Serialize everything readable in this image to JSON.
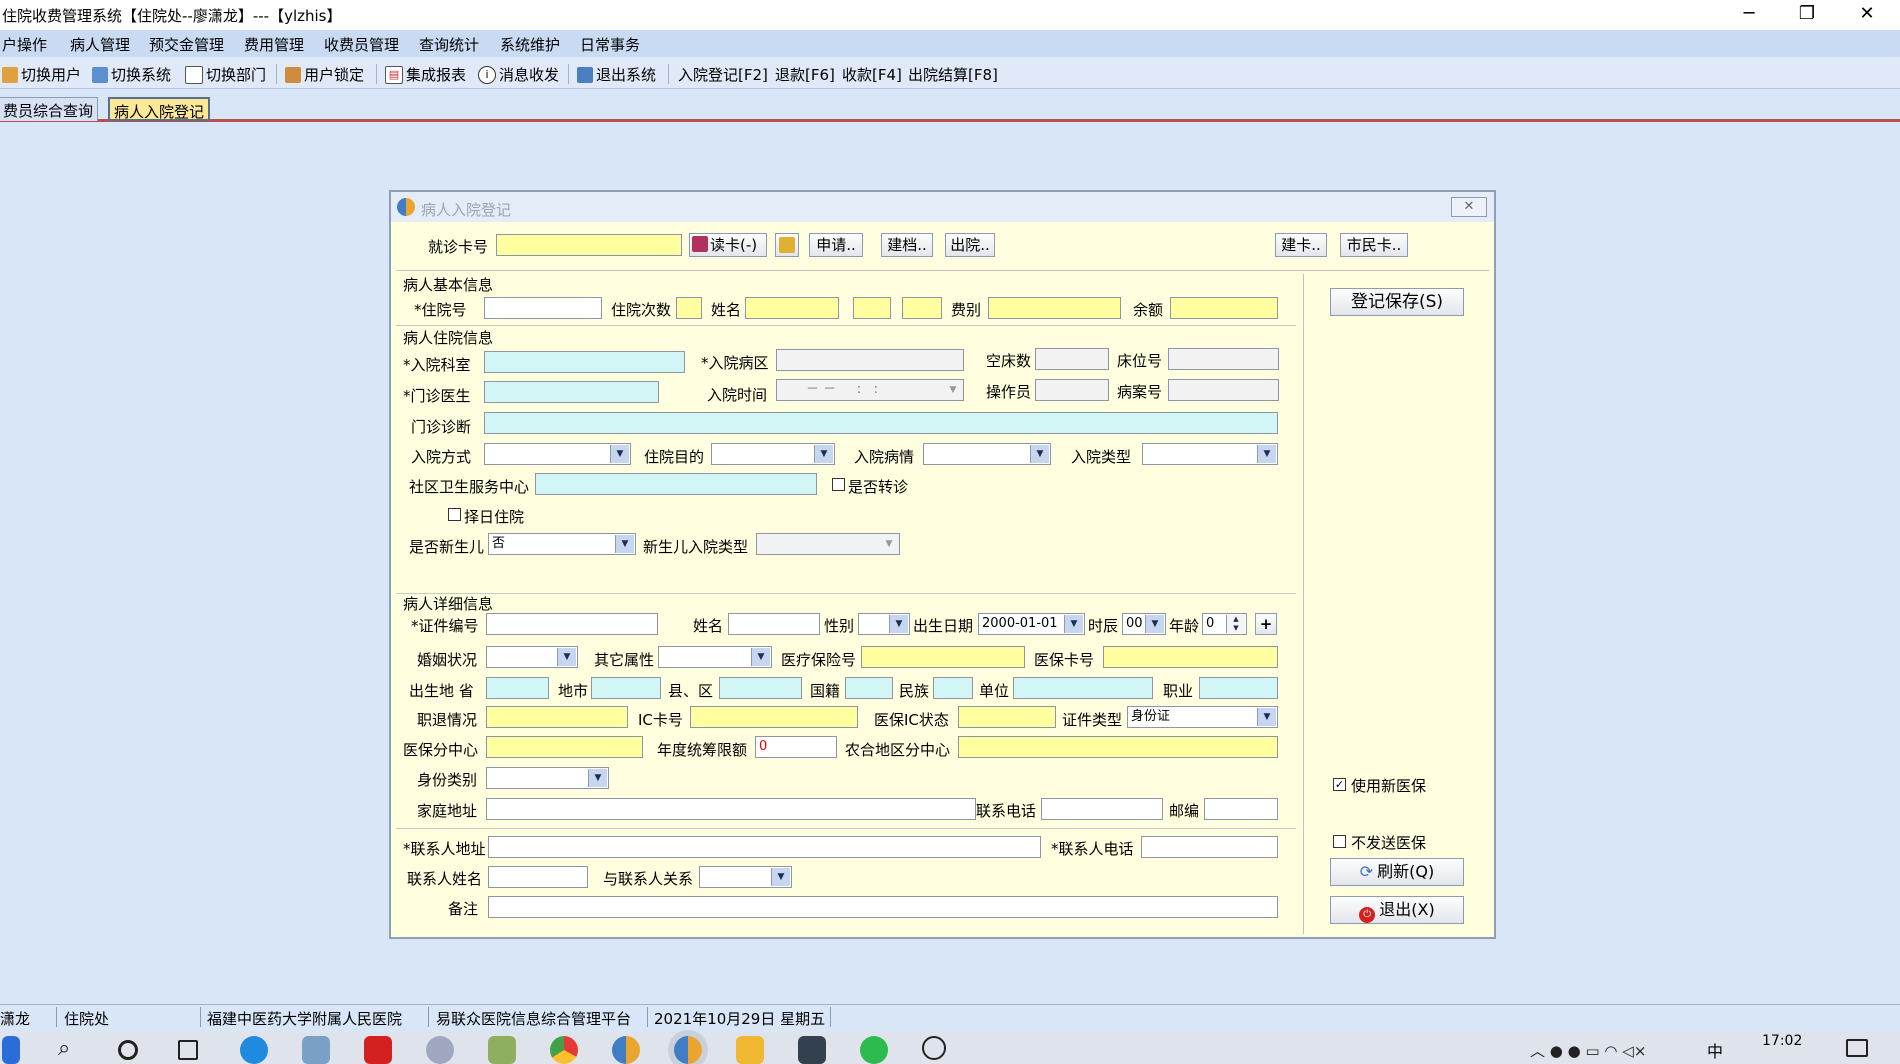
{
  "app": {
    "title": "住院收费管理系统【住院处--廖潇龙】---【ylzhis】"
  },
  "window_controls": {
    "minimize": "─",
    "restore": "❐",
    "close": "✕"
  },
  "menu": [
    "户操作",
    "病人管理",
    "预交金管理",
    "费用管理",
    "收费员管理",
    "查询统计",
    "系统维护",
    "日常事务"
  ],
  "toolbar": {
    "switch_user": "切换用户",
    "switch_system": "切换系统",
    "switch_dept": "切换部门",
    "lock_user": "用户锁定",
    "report": "集成报表",
    "message": "消息收发",
    "exit_system": "退出系统",
    "admit": "入院登记[F2]",
    "refund": "退款[F6]",
    "charge": "收款[F4]",
    "discharge": "出院结算[F8]"
  },
  "tabs": [
    "费员综合查询",
    "病人入院登记"
  ],
  "dialog": {
    "title": "病人入院登记",
    "close": "✕",
    "card": {
      "label": "就诊卡号",
      "read_card": "读卡(-)",
      "apply": "申请..",
      "build_file": "建档..",
      "discharge": "出院..",
      "build_card": "建卡..",
      "citizen_card": "市民卡.."
    },
    "sections": {
      "basic": "病人基本信息",
      "admission": "病人住院信息",
      "detail": "病人详细信息"
    },
    "basic": {
      "admission_no": "*住院号",
      "visit_count": "住院次数",
      "name": "姓名",
      "fee_type": "费别",
      "balance": "余额"
    },
    "admission": {
      "dept": "*入院科室",
      "ward": "*入院病区",
      "empty_beds": "空床数",
      "bed_no": "床位号",
      "doctor": "*门诊医生",
      "admit_time": "入院时间",
      "admit_time_value": "－ －     :   :",
      "operator": "操作员",
      "case_no": "病案号",
      "diagnosis": "门诊诊断",
      "admit_method": "入院方式",
      "purpose": "住院目的",
      "condition": "入院病情",
      "admit_type": "入院类型",
      "community": "社区卫生服务中心",
      "transfer": "是否转诊",
      "scheduled": "择日住院",
      "newborn": "是否新生儿",
      "newborn_value": "否",
      "newborn_type": "新生儿入院类型"
    },
    "detail": {
      "id_no": "*证件编号",
      "name": "姓名",
      "gender": "性别",
      "birth": "出生日期",
      "birth_value": "2000-01-01",
      "hour": "时辰",
      "hour_value": "00",
      "age": "年龄",
      "age_value": "0",
      "plus": "+",
      "marital": "婚姻状况",
      "other_attr": "其它属性",
      "insurance_no": "医疗保险号",
      "insurance_card": "医保卡号",
      "birthplace_province": "出生地 省",
      "city": "地市",
      "county": "县、区",
      "nationality": "国籍",
      "ethnicity": "民族",
      "employer": "单位",
      "occupation": "职业",
      "retire": "职退情况",
      "ic_card": "IC卡号",
      "ic_status": "医保IC状态",
      "cert_type": "证件类型",
      "cert_type_value": "身份证",
      "ins_center": "医保分中心",
      "annual_limit": "年度统筹限额",
      "annual_limit_value": "0",
      "rural_center": "农合地区分中心",
      "identity_type": "身份类别",
      "home_address": "家庭地址",
      "phone": "联系电话",
      "postcode": "邮编",
      "contact_address": "*联系人地址",
      "contact_phone": "*联系人电话",
      "contact_name": "联系人姓名",
      "relation": "与联系人关系",
      "remark": "备注"
    },
    "side": {
      "save": "登记保存(S)",
      "use_new_ins": "使用新医保",
      "no_send_ins": "不发送医保",
      "refresh": "刷新(Q)",
      "exit": "退出(X)"
    }
  },
  "status": [
    "潇龙",
    "住院处",
    "福建中医药大学附属人民医院",
    "易联众医院信息综合管理平台",
    "2021年10月29日 星期五"
  ],
  "taskbar": {
    "time": "17:02",
    "ime": "中"
  }
}
